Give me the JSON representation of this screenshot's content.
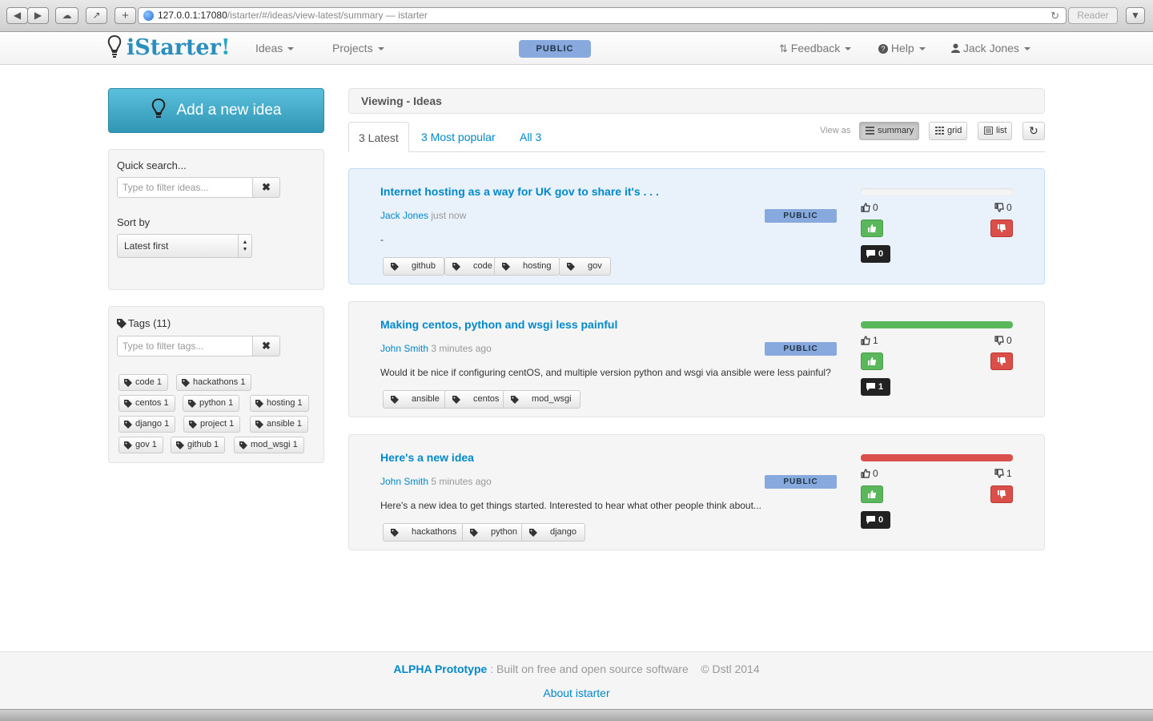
{
  "browser": {
    "url_host": "127.0.0.1:17080",
    "url_path": "/istarter/#/ideas/view-latest/summary — istarter",
    "reader_label": "Reader"
  },
  "navbar": {
    "brand_text": "iStarter",
    "brand_bang": "!",
    "ideas_label": "Ideas",
    "projects_label": "Projects",
    "public_label": "PUBLIC",
    "feedback_label": "Feedback",
    "help_label": "Help",
    "user_label": "Jack Jones"
  },
  "sidebar": {
    "add_idea_label": "Add a new idea",
    "quick_search_label": "Quick search...",
    "quick_search_placeholder": "Type to filter ideas...",
    "sort_by_label": "Sort by",
    "sort_selected": "Latest first",
    "tags_label": "Tags (11)",
    "tags_placeholder": "Type to filter tags...",
    "tag_cloud": [
      {
        "label": "code 1"
      },
      {
        "label": "hackathons 1"
      },
      {
        "label": "centos 1"
      },
      {
        "label": "python 1"
      },
      {
        "label": "hosting 1"
      },
      {
        "label": "django 1"
      },
      {
        "label": "project 1"
      },
      {
        "label": "ansible 1"
      },
      {
        "label": "gov 1"
      },
      {
        "label": "github 1"
      },
      {
        "label": "mod_wsgi 1"
      }
    ]
  },
  "main": {
    "heading": "Viewing - Ideas",
    "tabs": [
      {
        "label": "3 Latest",
        "active": true
      },
      {
        "label": "3 Most popular",
        "active": false
      },
      {
        "label": "All 3",
        "active": false
      }
    ],
    "view_as_label": "View as",
    "view_buttons": [
      {
        "label": "summary",
        "active": true
      },
      {
        "label": "grid",
        "active": false
      },
      {
        "label": "list",
        "active": false
      }
    ],
    "ideas": [
      {
        "title": "Internet hosting as a way for UK gov to share it's . . .",
        "author": "Jack Jones",
        "time": "just now",
        "description": "-",
        "status": "PUBLIC",
        "tags": [
          "github",
          "code",
          "hosting",
          "gov"
        ],
        "likes": "0",
        "dislikes": "0",
        "comments": "0",
        "like_fraction": 0,
        "dislike_fraction": 0
      },
      {
        "title": "Making centos, python and wsgi less painful",
        "author": "John Smith",
        "time": "3 minutes ago",
        "description": "Would it be nice if configuring centOS, and multiple version python and wsgi via ansible were less painful?",
        "status": "PUBLIC",
        "tags": [
          "ansible",
          "centos",
          "mod_wsgi"
        ],
        "likes": "1",
        "dislikes": "0",
        "comments": "1",
        "like_fraction": 1,
        "dislike_fraction": 0
      },
      {
        "title": "Here's a new idea",
        "author": "John Smith",
        "time": "5 minutes ago",
        "description": "Here's a new idea to get things started. Interested to hear what other people think about...",
        "status": "PUBLIC",
        "tags": [
          "hackathons",
          "python",
          "django"
        ],
        "likes": "0",
        "dislikes": "1",
        "comments": "0",
        "like_fraction": 0,
        "dislike_fraction": 1
      }
    ]
  },
  "footer": {
    "alpha_label": "ALPHA Prototype",
    "built_text": ": Built on free and open source software",
    "copyright": "© Dstl 2014",
    "about_label": "About istarter"
  },
  "colors": {
    "link": "#0088cc",
    "public_badge": "#88a9de",
    "vote_up": "#5bb75b",
    "vote_down": "#da4f49",
    "info_button": "#5bc0de"
  }
}
